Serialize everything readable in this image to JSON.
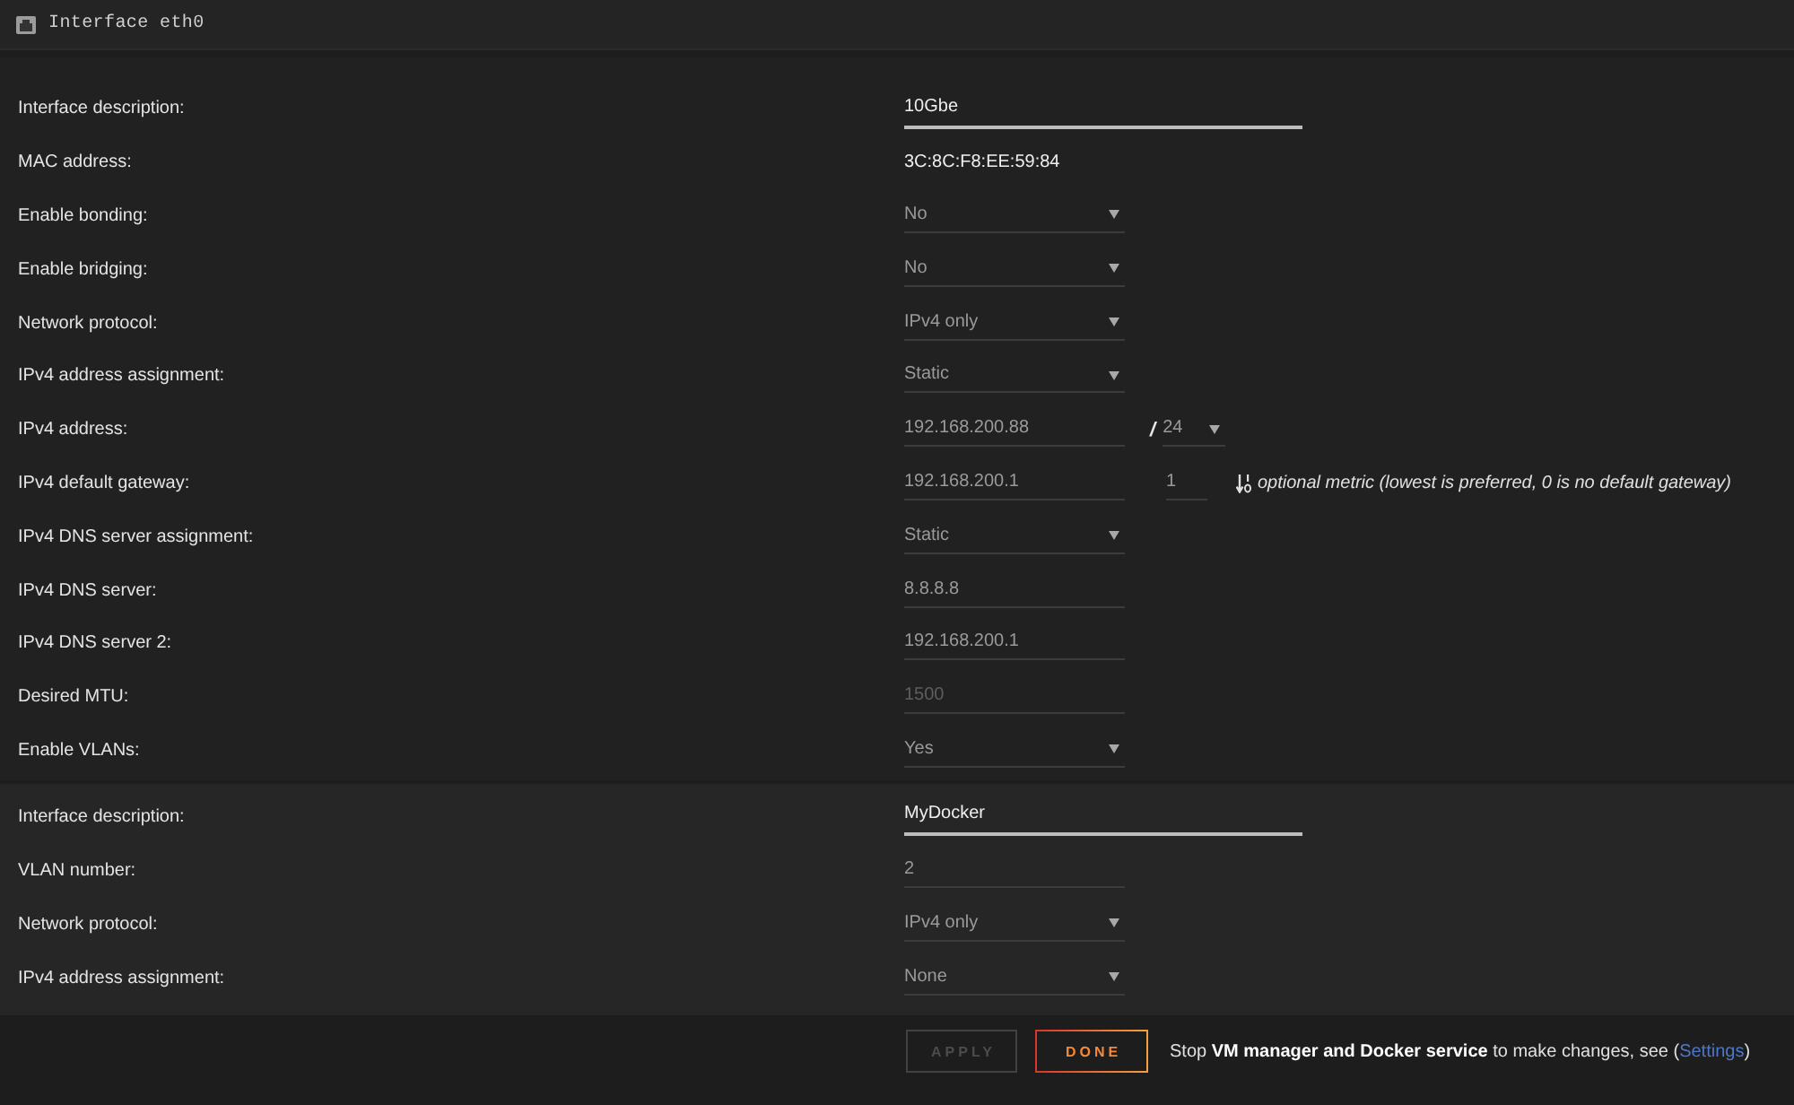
{
  "header": {
    "title": "Interface eth0"
  },
  "interface_settings": {
    "rows": [
      {
        "label": "Interface description:",
        "kind": "text",
        "value": "10Gbe",
        "disabled": false
      },
      {
        "label": "MAC address:",
        "kind": "static",
        "value": "3C:8C:F8:EE:59:84",
        "disabled": false
      },
      {
        "label": "Enable bonding:",
        "kind": "select",
        "value": "No",
        "disabled": true
      },
      {
        "label": "Enable bridging:",
        "kind": "select",
        "value": "No",
        "disabled": true
      },
      {
        "label": "Network protocol:",
        "kind": "select",
        "value": "IPv4 only",
        "disabled": true
      },
      {
        "label": "IPv4 address assignment:",
        "kind": "select",
        "value": "Static",
        "disabled": true
      },
      {
        "label": "IPv4 address:",
        "kind": "address",
        "value": "192.168.200.88",
        "separator": "/",
        "prefix": "24",
        "disabled": true
      },
      {
        "label": "IPv4 default gateway:",
        "kind": "gateway",
        "value": "192.168.200.1",
        "metric": "1",
        "hint": "optional metric (lowest is preferred, 0 is no default gateway)",
        "disabled": true
      },
      {
        "label": "IPv4 DNS server assignment:",
        "kind": "select",
        "value": "Static",
        "disabled": true
      },
      {
        "label": "IPv4 DNS server:",
        "kind": "input",
        "value": "8.8.8.8",
        "disabled": true
      },
      {
        "label": "IPv4 DNS server 2:",
        "kind": "input",
        "value": "192.168.200.1",
        "disabled": true
      },
      {
        "label": "Desired MTU:",
        "kind": "input",
        "placeholder": "1500",
        "disabled": true
      },
      {
        "label": "Enable VLANs:",
        "kind": "select",
        "value": "Yes",
        "disabled": true
      }
    ]
  },
  "vlan_settings": {
    "rows": [
      {
        "label": "Interface description:",
        "kind": "text",
        "value": "MyDocker",
        "disabled": false
      },
      {
        "label": "VLAN number:",
        "kind": "input",
        "value": "2",
        "disabled": true
      },
      {
        "label": "Network protocol:",
        "kind": "select",
        "value": "IPv4 only",
        "disabled": true
      },
      {
        "label": "IPv4 address assignment:",
        "kind": "select",
        "value": "None",
        "disabled": true
      }
    ]
  },
  "actions": {
    "buttons": [
      {
        "label": "APPLY",
        "disabled": true
      },
      {
        "label": "DONE",
        "disabled": false
      }
    ],
    "notice": {
      "text_before": "Stop **VM manager and Docker service** to make changes, see (",
      "link": "Settings",
      "text_after": ")"
    }
  }
}
